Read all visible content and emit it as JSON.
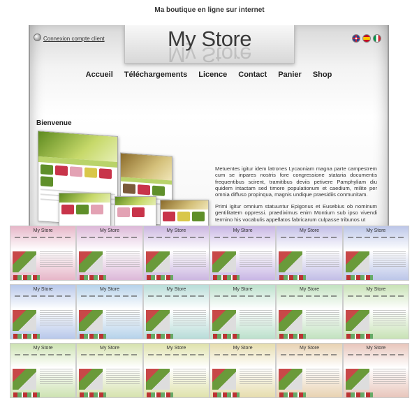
{
  "tagline": "Ma boutique en ligne sur internet",
  "header": {
    "logo": "My Store",
    "login_link": "Connexion compte client",
    "flags": [
      "uk-flag",
      "spain-flag",
      "italy-flag"
    ]
  },
  "nav": [
    "Accueil",
    "Téléchargements",
    "Licence",
    "Contact",
    "Panier",
    "Shop"
  ],
  "welcome": "Bienvenue",
  "paragraphs": [
    "Metuentes igitur idem latrones Lycaoniam magna parte campestrem cum se inpares nostris fore congressione stataria documentis frequentibus scirent, tramitibus deviis petivere Pamphyliam diu quidem intactam sed timore populationum et caedium, milite per omnia diffuso propinqua, magnis undique praesidiis conmunitam.",
    "Primi igitur omnium statuuntur Epigonus et Eusebius ob nominum gentilitatem oppressi. praediximus enim Montium sub ipso vivendi termino his vocabulis appellatos fabricarum culpasse tribunos ut"
  ],
  "theme_variants": [
    "#e6b6c8",
    "#dcb8d8",
    "#cbb6e0",
    "#c8b6e4",
    "#c2bee6",
    "#bcc6e8",
    "#b8c8ea",
    "#b6d2ea",
    "#b8dcd8",
    "#bce0cc",
    "#c2e2c0",
    "#c8e2b6",
    "#cde2b2",
    "#d6e2ae",
    "#dfe2ac",
    "#e6ddae",
    "#e8d2b2",
    "#e8c6bc"
  ]
}
